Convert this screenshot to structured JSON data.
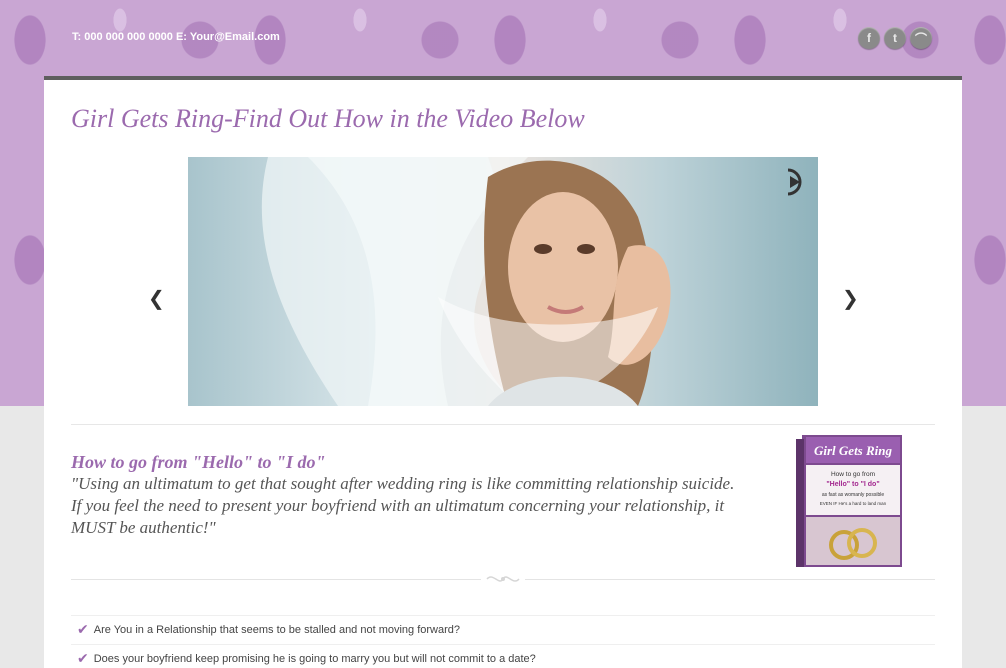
{
  "header": {
    "contact": "T: 000 000 000 0000 E: Your@Email.com",
    "social": [
      {
        "icon": "facebook-icon",
        "glyph": "f"
      },
      {
        "icon": "twitter-icon",
        "glyph": "t"
      },
      {
        "icon": "rss-icon",
        "glyph": "⌒"
      }
    ]
  },
  "main": {
    "title": "Girl Gets Ring-Find Out How in the Video Below",
    "slider": {
      "prev": "❮",
      "next": "❯"
    },
    "sub_heading": "How to go from \"Hello\" to \"I do\"",
    "quote": "\"Using an ultimatum to get that sought after wedding ring is like committing relationship suicide. If you feel the need to present your boyfriend with an ultimatum concerning your relationship, it MUST be authentic!\"",
    "book": {
      "title": "Girl Gets Ring",
      "line1": "How to go from",
      "line2": "\"Hello\" to \"I do\"",
      "line3": "as fast as womanly possible",
      "line4": "EVEN IF He's a hard to land man"
    },
    "checklist": [
      "Are You in a Relationship that seems to be stalled and not moving forward?",
      "Does your boyfriend keep promising he is going to marry you but will not commit to a date?"
    ]
  },
  "colors": {
    "accent": "#9b6aae",
    "pattern": "#c9a6d3"
  }
}
